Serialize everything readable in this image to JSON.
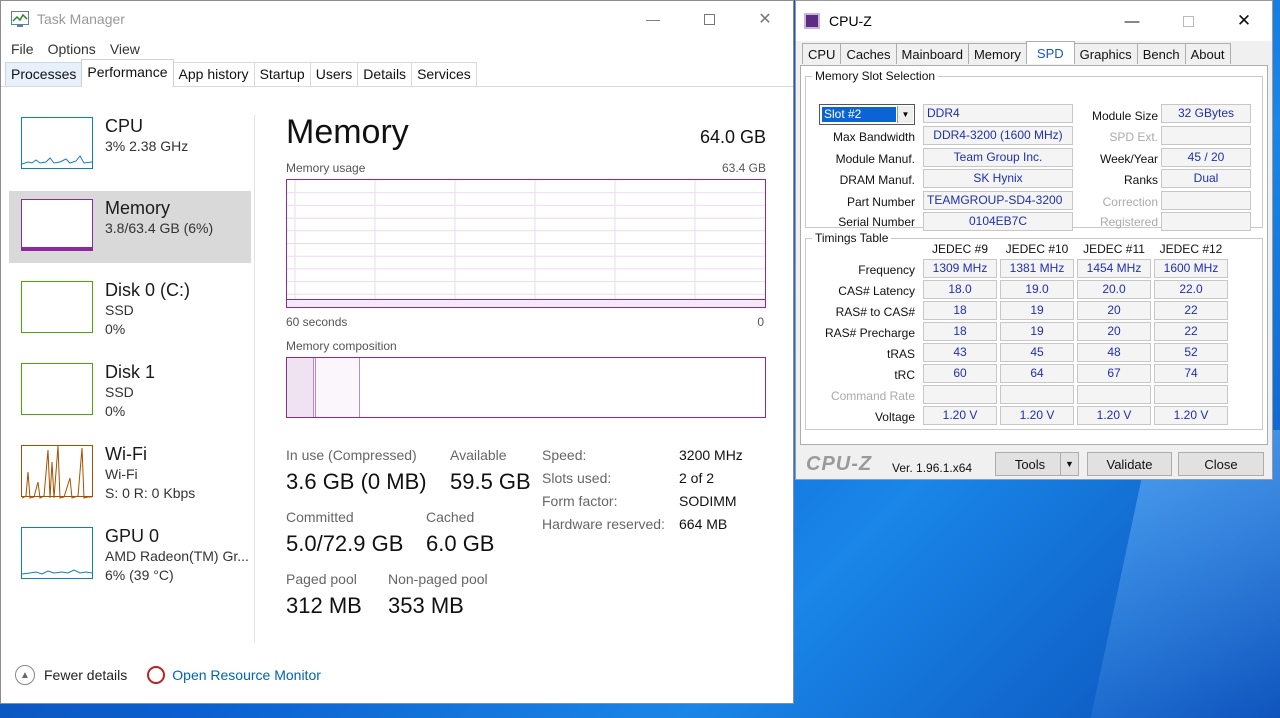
{
  "taskmanager": {
    "title": "Task Manager",
    "menu": [
      "File",
      "Options",
      "View"
    ],
    "tabs": [
      "Processes",
      "Performance",
      "App history",
      "Startup",
      "Users",
      "Details",
      "Services"
    ],
    "sidebar": [
      {
        "name": "CPU",
        "line1": "3%  2.38 GHz",
        "line2": ""
      },
      {
        "name": "Memory",
        "line1": "3.8/63.4 GB (6%)",
        "line2": ""
      },
      {
        "name": "Disk 0 (C:)",
        "line1": "SSD",
        "line2": "0%"
      },
      {
        "name": "Disk 1",
        "line1": "SSD",
        "line2": "0%"
      },
      {
        "name": "Wi-Fi",
        "line1": "Wi-Fi",
        "line2": "S: 0  R: 0 Kbps"
      },
      {
        "name": "GPU 0",
        "line1": "AMD Radeon(TM) Gr...",
        "line2": "6% (39 °C)"
      }
    ],
    "memory": {
      "title": "Memory",
      "total": "64.0 GB",
      "usage_label": "Memory usage",
      "usage_max": "63.4 GB",
      "usage_fraction": 0.06,
      "time_label": "60 seconds",
      "time_zero": "0",
      "composition_label": "Memory composition",
      "in_use_label": "In use (Compressed)",
      "in_use_value": "3.6 GB (0 MB)",
      "available_label": "Available",
      "available_value": "59.5 GB",
      "committed_label": "Committed",
      "committed_value": "5.0/72.9 GB",
      "cached_label": "Cached",
      "cached_value": "6.0 GB",
      "paged_label": "Paged pool",
      "paged_value": "312 MB",
      "nonpaged_label": "Non-paged pool",
      "nonpaged_value": "353 MB",
      "speed_label": "Speed:",
      "speed_value": "3200 MHz",
      "slots_label": "Slots used:",
      "slots_value": "2 of 2",
      "form_label": "Form factor:",
      "form_value": "SODIMM",
      "hwres_label": "Hardware reserved:",
      "hwres_value": "664 MB"
    },
    "footer": {
      "fewer_details": "Fewer details",
      "open_resmon": "Open Resource Monitor"
    }
  },
  "cpuz": {
    "title": "CPU-Z",
    "tabs": [
      "CPU",
      "Caches",
      "Mainboard",
      "Memory",
      "SPD",
      "Graphics",
      "Bench",
      "About"
    ],
    "slot_group_title": "Memory Slot Selection",
    "slot_selected": "Slot #2",
    "mem_type": "DDR4",
    "module_size_label": "Module Size",
    "module_size": "32 GBytes",
    "max_bw_label": "Max Bandwidth",
    "max_bw": "DDR4-3200 (1600 MHz)",
    "spd_ext_label": "SPD Ext.",
    "module_manuf_label": "Module Manuf.",
    "module_manuf": "Team Group Inc.",
    "week_year_label": "Week/Year",
    "week_year": "45 / 20",
    "dram_manuf_label": "DRAM Manuf.",
    "dram_manuf": "SK Hynix",
    "ranks_label": "Ranks",
    "ranks": "Dual",
    "part_label": "Part Number",
    "part": "TEAMGROUP-SD4-3200",
    "correction_label": "Correction",
    "serial_label": "Serial Number",
    "serial": "0104EB7C",
    "registered_label": "Registered",
    "timings_title": "Timings Table",
    "timing_headers": [
      "JEDEC #9",
      "JEDEC #10",
      "JEDEC #11",
      "JEDEC #12"
    ],
    "timing_rows": [
      {
        "label": "Frequency",
        "values": [
          "1309 MHz",
          "1381 MHz",
          "1454 MHz",
          "1600 MHz"
        ]
      },
      {
        "label": "CAS# Latency",
        "values": [
          "18.0",
          "19.0",
          "20.0",
          "22.0"
        ]
      },
      {
        "label": "RAS# to CAS#",
        "values": [
          "18",
          "19",
          "20",
          "22"
        ]
      },
      {
        "label": "RAS# Precharge",
        "values": [
          "18",
          "19",
          "20",
          "22"
        ]
      },
      {
        "label": "tRAS",
        "values": [
          "43",
          "45",
          "48",
          "52"
        ]
      },
      {
        "label": "tRC",
        "values": [
          "60",
          "64",
          "67",
          "74"
        ]
      },
      {
        "label": "Command Rate",
        "values": [
          "",
          "",
          "",
          ""
        ]
      },
      {
        "label": "Voltage",
        "values": [
          "1.20 V",
          "1.20 V",
          "1.20 V",
          "1.20 V"
        ]
      }
    ],
    "brand": "CPU-Z",
    "version": "Ver. 1.96.1.x64",
    "tools_label": "Tools",
    "validate_label": "Validate",
    "close_label": "Close"
  },
  "colors": {
    "memory_accent": "#8b2a9c",
    "cpu_accent": "#117dbb",
    "disk_accent": "#4da60c",
    "wifi_accent": "#a74f01",
    "cpuz_value": "#1f2fb0"
  }
}
